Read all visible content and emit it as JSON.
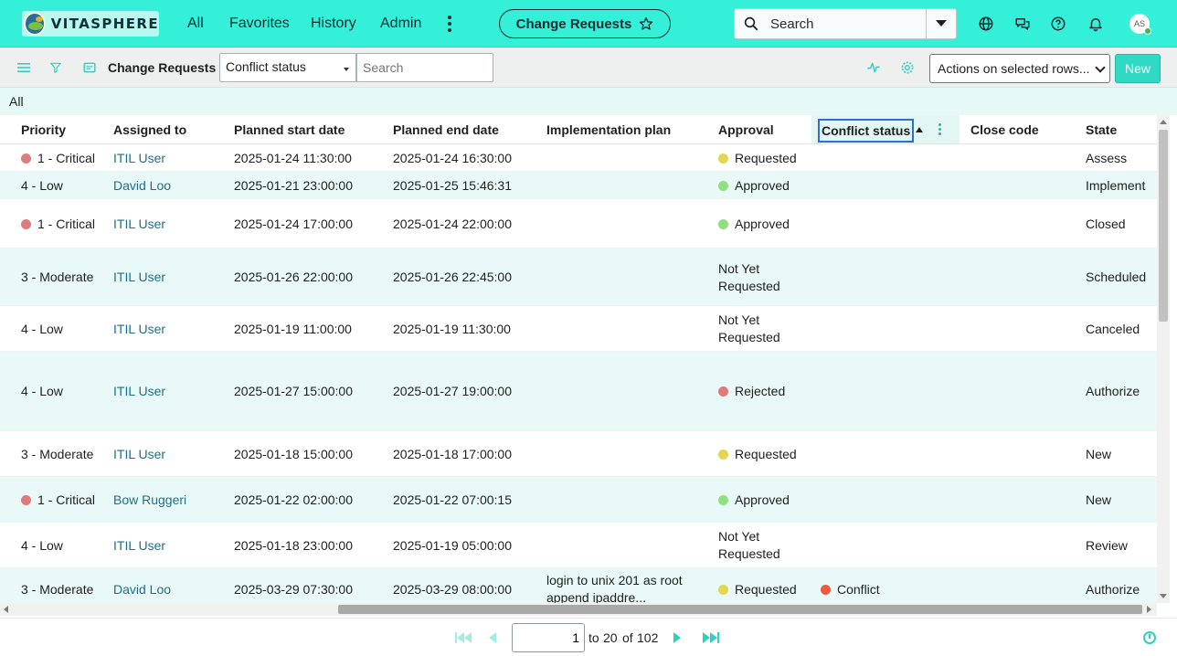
{
  "header": {
    "brand": "VITASPHERE",
    "nav": [
      "All",
      "Favorites",
      "History",
      "Admin"
    ],
    "context_pill": "Change Requests",
    "search_label": "Search",
    "avatar_initials": "AS",
    "accent_color": "#34f0d8"
  },
  "toolbar": {
    "list_title": "Change Requests",
    "field_select_value": "Conflict status",
    "search_placeholder": "Search",
    "actions_select_value": "Actions on selected rows...",
    "new_button": "New"
  },
  "breadcrumb": "All",
  "table": {
    "columns": [
      "Priority",
      "Assigned to",
      "Planned start date",
      "Planned end date",
      "Implementation plan",
      "Approval",
      "Conflict status",
      "Close code",
      "State"
    ],
    "sorted_column": "Conflict status",
    "sort_direction": "ascending",
    "rows": [
      {
        "priority": "1 - Critical",
        "priority_dot": true,
        "assigned": "ITIL User",
        "start": "2025-01-24 11:30:00",
        "end": "2025-01-24 16:30:00",
        "plan": "",
        "approval": "Requested",
        "approval_color": "#e3d752",
        "conflict": "",
        "close_code": "",
        "state": "Assess"
      },
      {
        "priority": "4 - Low",
        "priority_dot": false,
        "assigned": "David Loo",
        "start": "2025-01-21 23:00:00",
        "end": "2025-01-25 15:46:31",
        "plan": "",
        "approval": "Approved",
        "approval_color": "#8fe07e",
        "conflict": "",
        "close_code": "",
        "state": "Implement"
      },
      {
        "priority": "1 - Critical",
        "priority_dot": true,
        "assigned": "ITIL User",
        "start": "2025-01-24 17:00:00",
        "end": "2025-01-24 22:00:00",
        "plan": "",
        "approval": "Approved",
        "approval_color": "#8fe07e",
        "conflict": "",
        "close_code": "",
        "state": "Closed"
      },
      {
        "priority": "3 - Moderate",
        "priority_dot": false,
        "assigned": "ITIL User",
        "start": "2025-01-26 22:00:00",
        "end": "2025-01-26 22:45:00",
        "plan": "",
        "approval": "Not Yet Requested",
        "approval_color": "",
        "conflict": "",
        "close_code": "",
        "state": "Scheduled"
      },
      {
        "priority": "4 - Low",
        "priority_dot": false,
        "assigned": "ITIL User",
        "start": "2025-01-19 11:00:00",
        "end": "2025-01-19 11:30:00",
        "plan": "",
        "approval": "Not Yet Requested",
        "approval_color": "",
        "conflict": "",
        "close_code": "",
        "state": "Canceled"
      },
      {
        "priority": "4 - Low",
        "priority_dot": false,
        "assigned": "ITIL User",
        "start": "2025-01-27 15:00:00",
        "end": "2025-01-27 19:00:00",
        "plan": "",
        "approval": "Rejected",
        "approval_color": "#de7c7c",
        "conflict": "",
        "close_code": "",
        "state": "Authorize"
      },
      {
        "priority": "3 - Moderate",
        "priority_dot": false,
        "assigned": "ITIL User",
        "start": "2025-01-18 15:00:00",
        "end": "2025-01-18 17:00:00",
        "plan": "",
        "approval": "Requested",
        "approval_color": "#e3d752",
        "conflict": "",
        "close_code": "",
        "state": "New"
      },
      {
        "priority": "1 - Critical",
        "priority_dot": true,
        "assigned": "Bow Ruggeri",
        "start": "2025-01-22 02:00:00",
        "end": "2025-01-22 07:00:15",
        "plan": "",
        "approval": "Approved",
        "approval_color": "#8fe07e",
        "conflict": "",
        "close_code": "",
        "state": "New"
      },
      {
        "priority": "4 - Low",
        "priority_dot": false,
        "assigned": "ITIL User",
        "start": "2025-01-18 23:00:00",
        "end": "2025-01-19 05:00:00",
        "plan": "",
        "approval": "Not Yet Requested",
        "approval_color": "",
        "conflict": "",
        "close_code": "",
        "state": "Review"
      },
      {
        "priority": "3 - Moderate",
        "priority_dot": false,
        "assigned": "David Loo",
        "start": "2025-03-29 07:30:00",
        "end": "2025-03-29 08:00:00",
        "plan": "login to unix 201 as root append ipaddre...",
        "approval": "Requested",
        "approval_color": "#e3d752",
        "conflict": "Conflict",
        "conflict_color": "#f05a3c",
        "close_code": "",
        "state": "Authorize"
      }
    ]
  },
  "pagination": {
    "current_page": "1",
    "range_end": "20",
    "of_label": "of",
    "total": "102",
    "to_label": "to"
  },
  "colors": {
    "critical_dot": "#de7c7c",
    "link": "#1e6f8a",
    "stripe": "#e9f9f7"
  }
}
